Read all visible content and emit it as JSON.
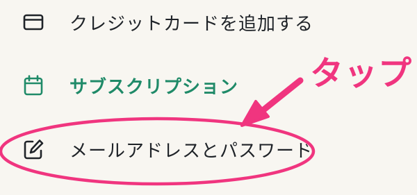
{
  "menu": {
    "items": [
      {
        "label": "クレジットカードを追加する",
        "icon": "credit-card-icon",
        "color": "#1f2328"
      },
      {
        "label": "サブスクリプション",
        "icon": "calendar-icon",
        "color": "#1f8a68"
      },
      {
        "label": "メールアドレスとパスワード",
        "icon": "edit-icon",
        "color": "#1f2328"
      }
    ]
  },
  "annotation": {
    "text": "タップ",
    "color": "#f0357f"
  }
}
